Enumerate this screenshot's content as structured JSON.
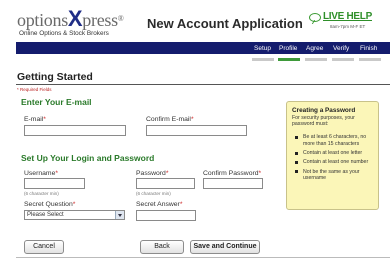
{
  "brand": {
    "name_part1": "options",
    "name_x": "X",
    "name_part2": "press",
    "reg": "®",
    "tagline": "Online Options & Stock Brokers"
  },
  "app_title": "New Account Application",
  "live_help": {
    "label": "LIVE HELP",
    "hours": "8am-7pm M-F ET"
  },
  "steps": [
    {
      "label": "Setup",
      "active": false
    },
    {
      "label": "Profile",
      "active": true
    },
    {
      "label": "Agree",
      "active": false
    },
    {
      "label": "Verify",
      "active": false
    },
    {
      "label": "Finish",
      "active": false
    }
  ],
  "page_title": "Getting Started",
  "required_note": "* Required Fields",
  "email_section": {
    "heading": "Enter Your E-mail",
    "email_label": "E-mail",
    "email_value": "",
    "confirm_label": "Confirm E-mail",
    "confirm_value": ""
  },
  "login_section": {
    "heading": "Set Up Your Login and Password",
    "username_label": "Username",
    "username_hint": "(6 character min)",
    "username_value": "",
    "password_label": "Password",
    "password_hint": "(6 character min)",
    "password_value": "",
    "confirm_password_label": "Confirm Password",
    "confirm_password_value": "",
    "secret_question_label": "Secret Question",
    "secret_question_selected": "Please Select",
    "secret_answer_label": "Secret Answer",
    "secret_answer_value": ""
  },
  "required_marker": "*",
  "password_help": {
    "title": "Creating a Password",
    "intro": "For security purposes, your password must:",
    "rules": [
      "Be at least 6 characters, no more than 15 characters",
      "Contain at least one letter",
      "Contain at least one number",
      "Not be the same as your username"
    ]
  },
  "buttons": {
    "cancel": "Cancel",
    "back": "Back",
    "save_continue": "Save and Continue"
  }
}
